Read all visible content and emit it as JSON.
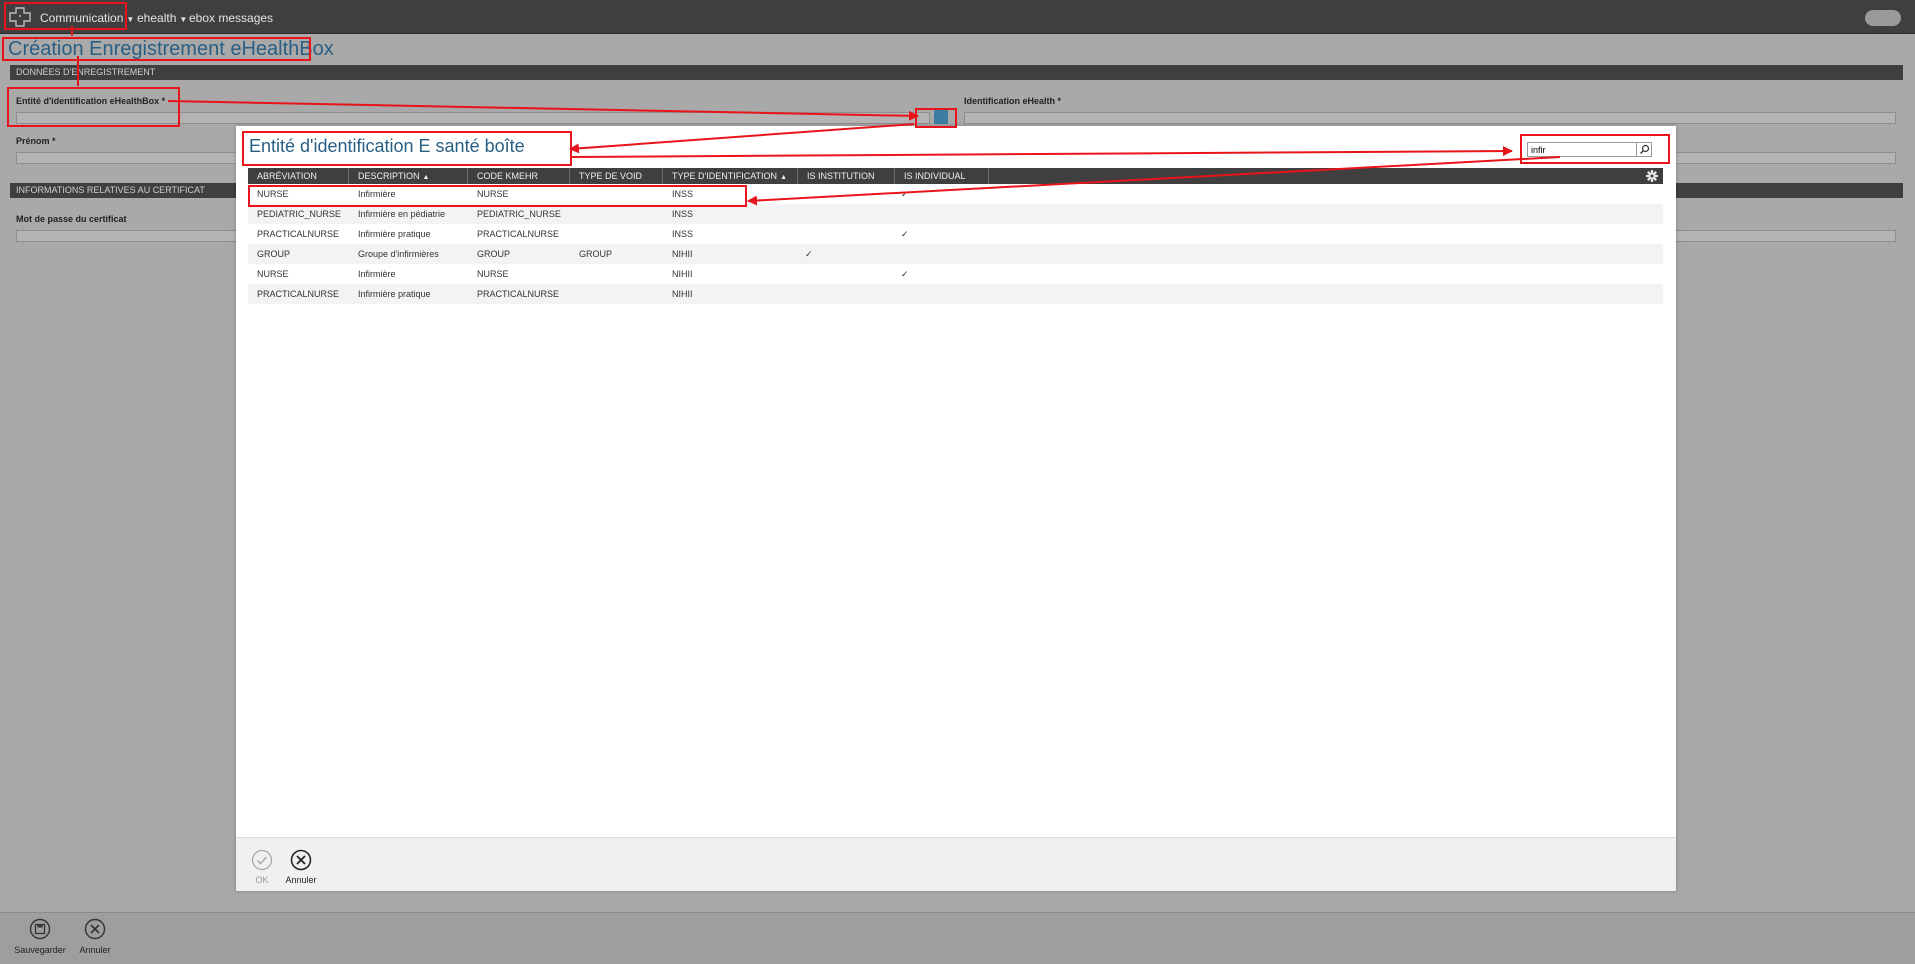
{
  "topbar": {
    "menu_communication": "Communication",
    "menu_ehealth": "ehealth",
    "menu_ebox": "ebox messages",
    "logo_icon": "medical-cross-icon",
    "caret_icon": "chevron-down-icon"
  },
  "page": {
    "title": "Création Enregistrement eHealthBox",
    "section_registration": "DONNÉES D'ENREGISTREMENT",
    "field_entity": "Entité d'identification eHealthBox *",
    "field_ehealth_id": "Identification eHealth *",
    "field_firstname": "Prénom *",
    "section_certificate": "INFORMATIONS RELATIVES AU CERTIFICAT",
    "field_cert_password": "Mot de passe du certificat"
  },
  "footer": {
    "save_label": "Sauvegarder",
    "cancel_label": "Annuler"
  },
  "modal": {
    "title": "Entité d'identification E santé boîte",
    "search_value": "infir",
    "columns": [
      "ABRÉVIATION",
      "DESCRIPTION",
      "CODE KMEHR",
      "TYPE DE VOID",
      "TYPE D'IDENTIFICATION",
      "IS INSTITUTION",
      "IS INDIVIDUAL"
    ],
    "sort_marker": "▲",
    "rows": [
      {
        "abbr": "NURSE",
        "desc": "Infirmière",
        "kmehr": "NURSE",
        "void": "",
        "idtype": "INSS",
        "inst": "",
        "indiv": "✓"
      },
      {
        "abbr": "PEDIATRIC_NURSE",
        "desc": "Infirmière en pédiatrie",
        "kmehr": "PEDIATRIC_NURSE",
        "void": "",
        "idtype": "INSS",
        "inst": "",
        "indiv": ""
      },
      {
        "abbr": "PRACTICALNURSE",
        "desc": "Infirmière pratique",
        "kmehr": "PRACTICALNURSE",
        "void": "",
        "idtype": "INSS",
        "inst": "",
        "indiv": "✓"
      },
      {
        "abbr": "GROUP",
        "desc": "Groupe d'infirmières",
        "kmehr": "GROUP",
        "void": "GROUP",
        "idtype": "NIHII",
        "inst": "✓",
        "indiv": ""
      },
      {
        "abbr": "NURSE",
        "desc": "Infirmière",
        "kmehr": "NURSE",
        "void": "",
        "idtype": "NIHII",
        "inst": "",
        "indiv": "✓"
      },
      {
        "abbr": "PRACTICALNURSE",
        "desc": "Infirmière pratique",
        "kmehr": "PRACTICALNURSE",
        "void": "",
        "idtype": "NIHII",
        "inst": "",
        "indiv": ""
      }
    ],
    "ok_label": "OK",
    "cancel_label": "Annuler"
  },
  "colors": {
    "accent": "#2a5f84",
    "header_dark": "#3f3f3f",
    "annotation_red": "#e8141b",
    "lookup_blue": "#3b7ea1"
  }
}
